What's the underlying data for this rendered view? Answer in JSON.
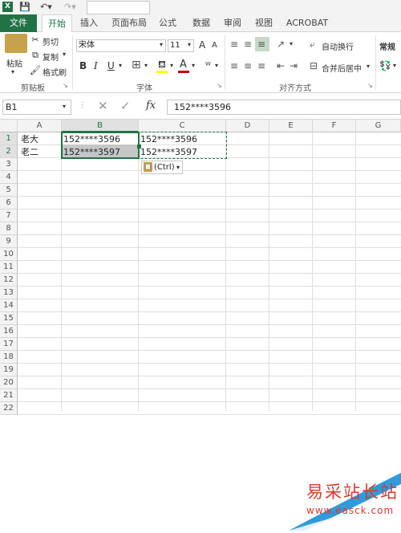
{
  "quick_access": {
    "app_icon": "X"
  },
  "tabs": [
    "文件",
    "开始",
    "插入",
    "页面布局",
    "公式",
    "数据",
    "审阅",
    "视图",
    "ACROBAT"
  ],
  "ribbon": {
    "clipboard": {
      "paste": "粘贴",
      "cut": "剪切",
      "copy": "复制",
      "format_painter": "格式刷",
      "group": "剪贴板"
    },
    "font": {
      "name": "宋体",
      "size": "11",
      "bold": "B",
      "italic": "I",
      "underline": "U",
      "group": "字体",
      "font_color_glyph": "A",
      "highlight_glyph": "A",
      "grow": "A",
      "shrink": "A"
    },
    "alignment": {
      "wrap": "自动换行",
      "merge": "合并后居中",
      "group": "对齐方式"
    },
    "number": {
      "format": "常规"
    }
  },
  "formula_bar": {
    "name_box": "B1",
    "fx": "fx",
    "value": "152****3596"
  },
  "columns": [
    "A",
    "B",
    "C",
    "D",
    "E",
    "F",
    "G"
  ],
  "rows": [
    "1",
    "2",
    "3",
    "4",
    "5",
    "6",
    "7",
    "8",
    "9",
    "10",
    "11",
    "12",
    "13",
    "14",
    "15",
    "16",
    "17",
    "18",
    "19",
    "20",
    "21",
    "22"
  ],
  "cells": {
    "A1": "老大",
    "B1": "152****3596",
    "C1": "152****3596",
    "A2": "老二",
    "B2": "152****3597",
    "C2": "152****3597"
  },
  "paste_options": {
    "label": "(Ctrl)"
  },
  "watermark": {
    "title": "易采站长站",
    "url": "www.easck.com"
  },
  "colors": {
    "accent": "#217346",
    "selection": "#c6c6c6",
    "marching": "#217346"
  }
}
